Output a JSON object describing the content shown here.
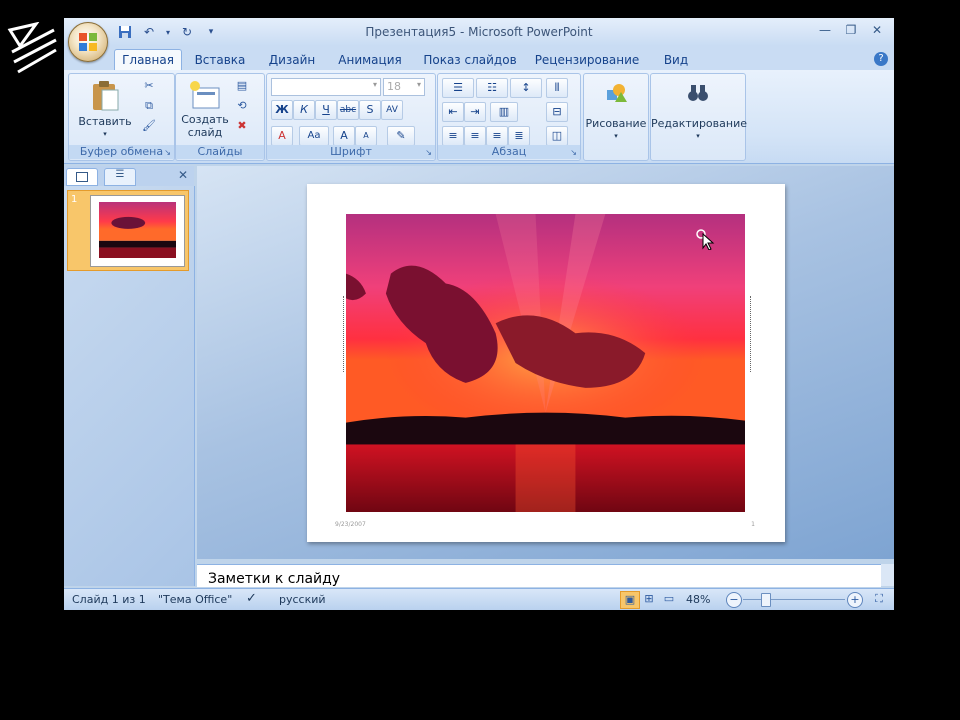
{
  "window": {
    "title": "Презентация5 - Microsoft PowerPoint"
  },
  "tabs": [
    {
      "label": "Главная",
      "active": true
    },
    {
      "label": "Вставка"
    },
    {
      "label": "Дизайн"
    },
    {
      "label": "Анимация"
    },
    {
      "label": "Показ слайдов"
    },
    {
      "label": "Рецензирование"
    },
    {
      "label": "Вид"
    }
  ],
  "ribbon": {
    "clipboard": {
      "group_label": "Буфер обмена",
      "paste_label": "Вставить"
    },
    "slides": {
      "group_label": "Слайды",
      "new_slide_label": "Создать слайд"
    },
    "font": {
      "group_label": "Шрифт",
      "size": "18",
      "bold": "Ж",
      "italic": "К",
      "underline": "Ч",
      "strike": "abc",
      "shadow": "S",
      "spacing": "AV",
      "aa": "Aa",
      "grow": "A",
      "shrink": "A"
    },
    "paragraph": {
      "group_label": "Абзац"
    },
    "drawing": {
      "label": "Рисование"
    },
    "editing": {
      "label": "Редактирование"
    }
  },
  "slides_pane": {
    "thumbnail_number": "1"
  },
  "slide": {
    "date": "9/23/2007",
    "number": "1"
  },
  "notes": {
    "placeholder": "Заметки к слайду"
  },
  "status_bar": {
    "slide_info": "Слайд 1 из 1",
    "theme": "\"Тема Office\"",
    "language": "русский",
    "zoom": "48%",
    "zoom_minus": "−",
    "zoom_plus": "+"
  },
  "colors": {
    "accent": "#15428b",
    "ribbon_bg": "#dbe8f8",
    "active_orange": "#f8c66a"
  }
}
